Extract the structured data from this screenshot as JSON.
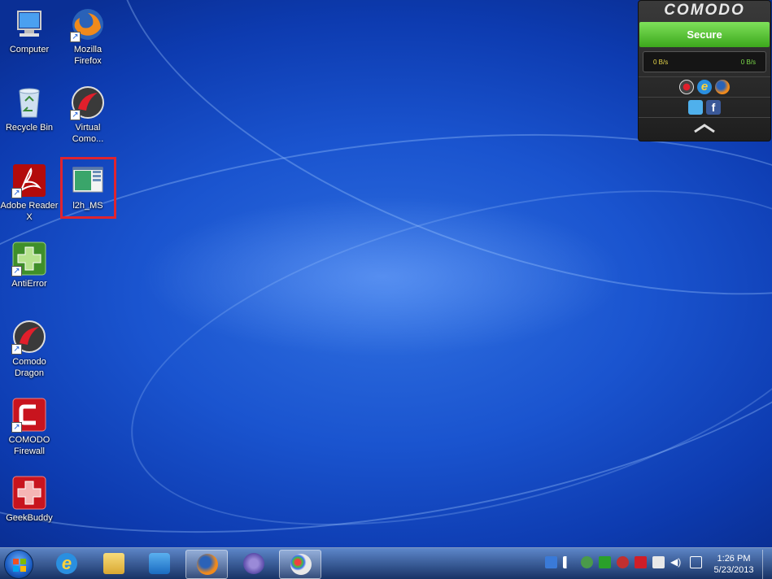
{
  "desktop": {
    "icons": [
      {
        "label": "Computer",
        "icon": "computer-icon"
      },
      {
        "label": "Mozilla\nFirefox",
        "icon": "firefox-icon"
      },
      {
        "label": "Recycle Bin",
        "icon": "recycle-bin-icon"
      },
      {
        "label": "Virtual\nComo...",
        "icon": "virtual-comodo-icon"
      },
      {
        "label": "Adobe Reader\nX",
        "icon": "adobe-reader-icon"
      },
      {
        "label": "l2h_MS",
        "icon": "l2h-file-icon",
        "selected": true
      },
      {
        "label": "AntiError",
        "icon": "antierror-icon"
      },
      {
        "label": "Comodo\nDragon",
        "icon": "comodo-dragon-icon"
      },
      {
        "label": "COMODO\nFirewall",
        "icon": "comodo-firewall-icon"
      },
      {
        "label": "GeekBuddy",
        "icon": "geekbuddy-icon"
      }
    ]
  },
  "widget": {
    "brand": "COMODO",
    "status": "Secure",
    "download": "0 B/s",
    "upload": "0 B/s",
    "browsers": [
      "comodo-dragon-icon",
      "internet-explorer-icon",
      "firefox-icon"
    ],
    "social": [
      "twitter-icon",
      "facebook-icon"
    ],
    "collapse": "chevron-up-icon"
  },
  "taskbar": {
    "pinned": [
      "internet-explorer-icon",
      "windows-explorer-icon",
      "media-player-icon",
      "firefox-icon",
      "virtual-comodo-icon",
      "paint-icon"
    ],
    "tray": [
      "network-helper-icon",
      "action-center-flag-icon",
      "update-icon",
      "network-icon",
      "antierror-tray-icon",
      "comodo-firewall-tray-icon",
      "power-icon",
      "volume-icon",
      "show-hidden-icon"
    ],
    "time": "1:26 PM",
    "date": "5/23/2013"
  },
  "colors": {
    "selection": "#e0242f",
    "secure_green": "#4cc226"
  }
}
